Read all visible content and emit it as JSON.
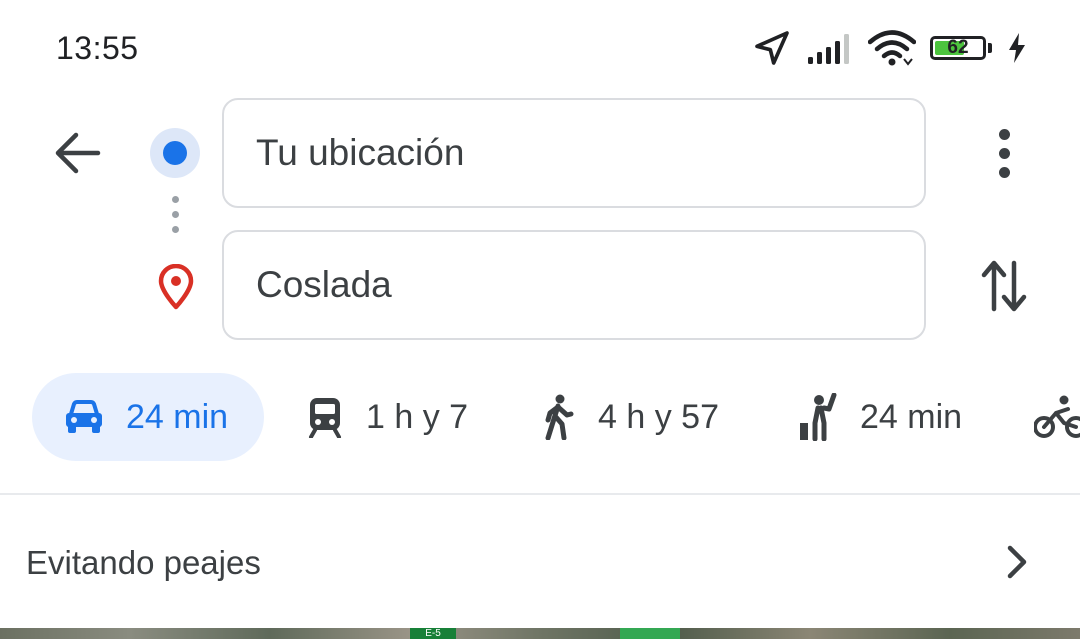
{
  "status_bar": {
    "time": "13:55",
    "battery_level": "62",
    "icons": [
      "location-arrow-icon",
      "signal-icon",
      "wifi-icon",
      "battery-icon",
      "charging-icon"
    ]
  },
  "directions": {
    "origin": "Tu ubicación",
    "destination": "Coslada"
  },
  "travel_modes": [
    {
      "mode": "drive",
      "icon": "car-icon",
      "label": "24 min",
      "selected": true
    },
    {
      "mode": "transit",
      "icon": "train-icon",
      "label": "1 h y 7",
      "selected": false
    },
    {
      "mode": "walk",
      "icon": "walking-icon",
      "label": "4 h y 57",
      "selected": false
    },
    {
      "mode": "ride",
      "icon": "hailing-icon",
      "label": "24 min",
      "selected": false
    },
    {
      "mode": "bike",
      "icon": "bicycle-icon",
      "label": "",
      "selected": false
    }
  ],
  "route_options": {
    "label": "Evitando peajes"
  },
  "map": {
    "road_label": "E-5"
  },
  "colors": {
    "accent": "#1a73e8",
    "selected_mode_bg": "#e8f0fe",
    "destination_pin": "#d93025",
    "battery_fill": "#4cc43e",
    "route_green": "#34a853"
  }
}
